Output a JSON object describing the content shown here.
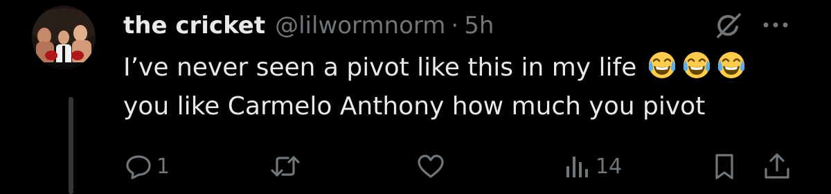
{
  "post": {
    "display_name": "the cricket",
    "handle": "@lilwormnorm",
    "separator": "·",
    "time": "5h",
    "text_line1": "I’ve never seen a pivot like this in my life",
    "text_line2": "you like Carmelo Anthony how much you pivot",
    "emojis": [
      "face-with-tears-of-joy",
      "face-with-tears-of-joy",
      "face-with-tears-of-joy"
    ]
  },
  "actions": {
    "reply_count": "1",
    "repost_count": "",
    "like_count": "",
    "views_count": "14"
  },
  "colors": {
    "background": "#000000",
    "primary_text": "#e7e9ea",
    "secondary_text": "#71767b",
    "thread_line": "#333639"
  },
  "icons": {
    "top_right": [
      "grok-icon",
      "more-icon"
    ],
    "action_bar": [
      "reply-icon",
      "repost-icon",
      "like-icon",
      "views-icon",
      "bookmark-icon",
      "share-icon"
    ]
  }
}
